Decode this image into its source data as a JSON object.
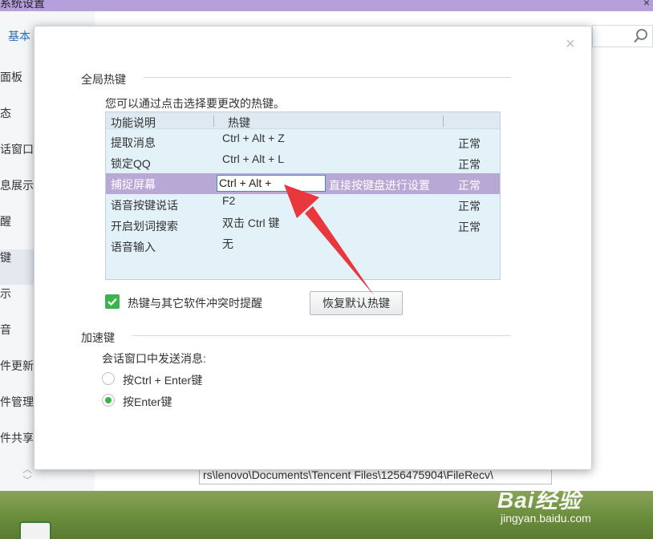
{
  "background_window": {
    "title": "系统设置",
    "close_glyph": "×",
    "tab_basic": "基本",
    "search_placeholder": "",
    "sidebar": [
      "面板",
      "态",
      "话窗口",
      "息展示",
      "醒",
      "键",
      "示",
      "音",
      "件更新",
      "件管理",
      "件共享"
    ],
    "scroll_up": "︿",
    "scroll_down": "﹀",
    "file_path": "rs\\lenovo\\Documents\\Tencent Files\\1256475904\\FileRecv\\"
  },
  "dialog": {
    "close_glyph": "×",
    "global_hotkeys_title": "全局热键",
    "hotkey_desc": "您可以通过点击选择要更改的热键。",
    "table": {
      "col_function": "功能说明",
      "col_hotkey": "热键",
      "rows": [
        {
          "function": "提取消息",
          "hotkey": "Ctrl + Alt + Z",
          "status": "正常"
        },
        {
          "function": "锁定QQ",
          "hotkey": "Ctrl + Alt + L",
          "status": "正常"
        },
        {
          "function": "捕捉屏幕",
          "hotkey": "Ctrl + Alt +",
          "hint": "直接按键盘进行设置",
          "status": "正常"
        },
        {
          "function": "语音按键说话",
          "hotkey": "F2",
          "status": "正常"
        },
        {
          "function": "开启划词搜索",
          "hotkey": "双击 Ctrl 键",
          "status": "正常"
        },
        {
          "function": "语音输入",
          "hotkey": "无",
          "status": ""
        }
      ]
    },
    "conflict_label": "热键与其它软件冲突时提醒",
    "conflict_checked": true,
    "restore_button": "恢复默认热键",
    "accel_title": "加速键",
    "send_desc": "会话窗口中发送消息:",
    "send_options": [
      {
        "label": "按Ctrl + Enter键",
        "checked": false
      },
      {
        "label": "按Enter键",
        "checked": true
      }
    ]
  },
  "watermark": {
    "logo": "Bai经验",
    "url": "jingyan.baidu.com"
  },
  "colors": {
    "selected_row": "#b8a8d6",
    "accent_green": "#3bb54a",
    "arrow_red": "#e8383d",
    "table_bg": "#e3f1f9"
  }
}
